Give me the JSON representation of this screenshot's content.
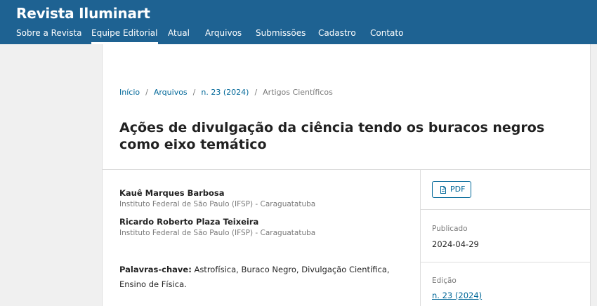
{
  "site": {
    "title": "Revista Iluminart"
  },
  "nav": {
    "items": [
      {
        "label": "Sobre a Revista"
      },
      {
        "label": "Equipe Editorial"
      },
      {
        "label": "Atual"
      },
      {
        "label": "Arquivos"
      },
      {
        "label": "Submissões"
      },
      {
        "label": "Cadastro"
      },
      {
        "label": "Contato"
      }
    ],
    "active": "Equipe Editorial"
  },
  "breadcrumb": {
    "home": "Início",
    "archives": "Arquivos",
    "issue": "n. 23 (2024)",
    "section": "Artigos Científicos",
    "separator": "/"
  },
  "article": {
    "title": "Ações de divulgação da ciência tendo os buracos negros como eixo temático",
    "authors": [
      {
        "name": "Kauê Marques Barbosa",
        "affiliation": "Instituto Federal de São Paulo (IFSP) - Caraguatatuba"
      },
      {
        "name": "Ricardo Roberto Plaza Teixeira",
        "affiliation": "Instituto Federal de São Paulo (IFSP) - Caraguatatuba"
      }
    ],
    "keywords_label": "Palavras-chave:",
    "keywords": "Astrofísica, Buraco Negro, Divulgação Científica, Ensino de Física."
  },
  "sidebar": {
    "pdf_label": "PDF",
    "published_label": "Publicado",
    "published_date": "2024-04-29",
    "issue_label": "Edição",
    "issue_link": "n. 23 (2024)"
  },
  "colors": {
    "header_bg": "#1e6292",
    "link": "#006798"
  },
  "icons": {
    "pdf": "file-pdf-icon"
  }
}
